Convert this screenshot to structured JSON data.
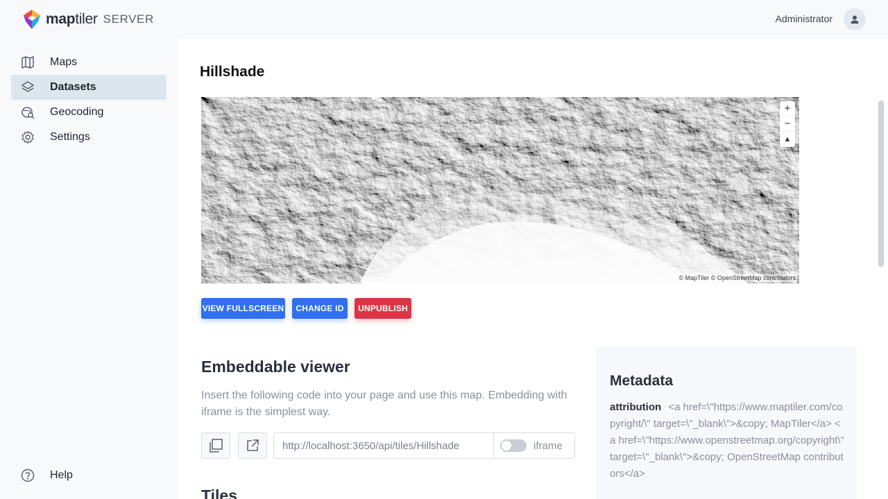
{
  "header": {
    "logo_bold": "map",
    "logo_light": "tiler",
    "logo_product": "SERVER",
    "user_name": "Administrator"
  },
  "sidebar": {
    "items": [
      {
        "label": "Maps",
        "icon": "map-icon",
        "active": false
      },
      {
        "label": "Datasets",
        "icon": "layers-icon",
        "active": true
      },
      {
        "label": "Geocoding",
        "icon": "geocoding-icon",
        "active": false
      },
      {
        "label": "Settings",
        "icon": "gear-icon",
        "active": false
      }
    ],
    "help_label": "Help"
  },
  "main": {
    "title": "Hillshade",
    "map": {
      "zoom_in": "+",
      "zoom_out": "−",
      "compass": "▲",
      "attribution": "© MapTiler © OpenStreetMap contributors"
    },
    "buttons": {
      "fullscreen": "VIEW FULLSCREEN",
      "change_id": "CHANGE ID",
      "unpublish": "UNPUBLISH"
    },
    "embed": {
      "title": "Embeddable viewer",
      "description": "Insert the following code into your page and use this map. Embedding with iframe is the simplest way.",
      "url": "http://localhost:3650/api/tiles/Hillshade",
      "toggle_label": "iframe",
      "iframe_enabled": false
    },
    "tiles_title": "Tiles",
    "metadata": {
      "title": "Metadata",
      "key": "attribution",
      "value": "<a href=\\\"https://www.maptiler.com/copyright/\\\" target=\\\"_blank\\\">&copy; MapTiler</a> <a href=\\\"https://www.openstreetmap.org/copyright\\\" target=\\\"_blank\\\">&copy; OpenStreetMap contributors</a>"
    }
  },
  "colors": {
    "primary": "#2f6ff0",
    "danger": "#dc3545",
    "active_nav": "#dde6ec"
  }
}
